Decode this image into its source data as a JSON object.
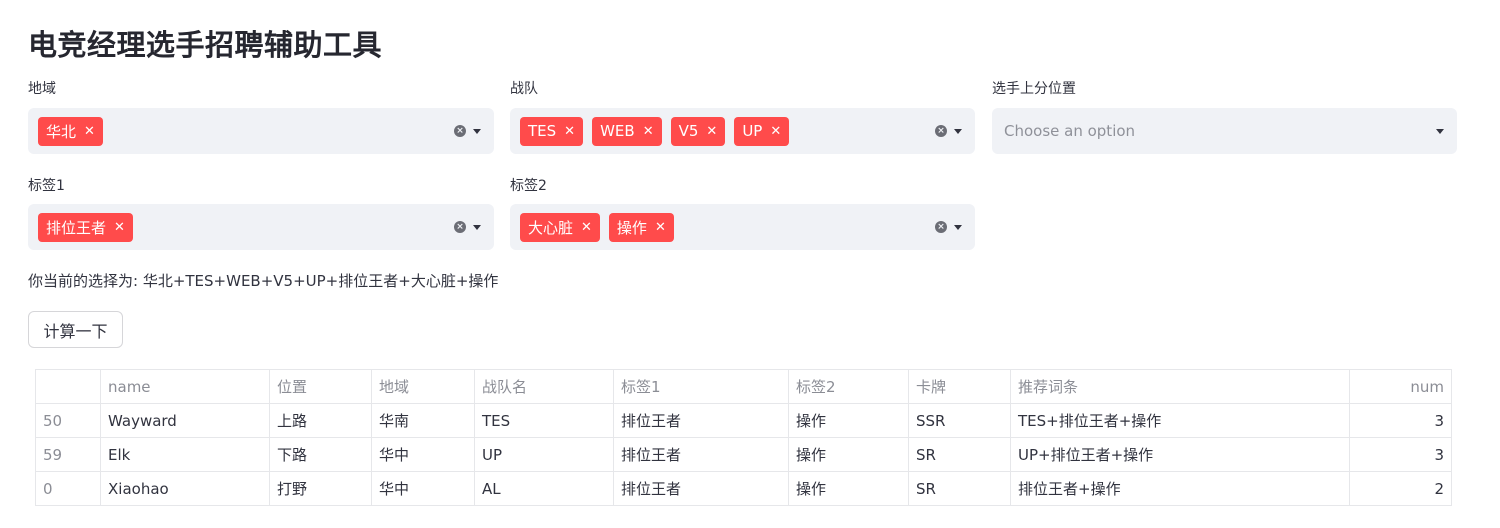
{
  "title": "电竞经理选手招聘辅助工具",
  "filters": {
    "region": {
      "label": "地域",
      "tags": [
        "华北"
      ]
    },
    "team": {
      "label": "战队",
      "tags": [
        "TES",
        "WEB",
        "V5",
        "UP"
      ]
    },
    "position": {
      "label": "选手上分位置",
      "placeholder": "Choose an option"
    },
    "tag1": {
      "label": "标签1",
      "tags": [
        "排位王者"
      ]
    },
    "tag2": {
      "label": "标签2",
      "tags": [
        "大心脏",
        "操作"
      ]
    }
  },
  "current_selection": "你当前的选择为: 华北+TES+WEB+V5+UP+排位王者+大心脏+操作",
  "calc_button": "计算一下",
  "table": {
    "columns": [
      "",
      "name",
      "位置",
      "地域",
      "战队名",
      "标签1",
      "标签2",
      "卡牌",
      "推荐词条",
      "num"
    ],
    "rows": [
      [
        "50",
        "Wayward",
        "上路",
        "华南",
        "TES",
        "排位王者",
        "操作",
        "SSR",
        "TES+排位王者+操作",
        "3"
      ],
      [
        "59",
        "Elk",
        "下路",
        "华中",
        "UP",
        "排位王者",
        "操作",
        "SR",
        "UP+排位王者+操作",
        "3"
      ],
      [
        "0",
        "Xiaohao",
        "打野",
        "华中",
        "AL",
        "排位王者",
        "操作",
        "SR",
        "排位王者+操作",
        "2"
      ]
    ]
  },
  "colors": {
    "tag_bg": "#ff4b4b",
    "select_bg": "#f0f2f6"
  },
  "icons": {
    "tag_remove": "close-icon",
    "clear": "clear-circle-icon",
    "dropdown": "caret-down-icon"
  }
}
